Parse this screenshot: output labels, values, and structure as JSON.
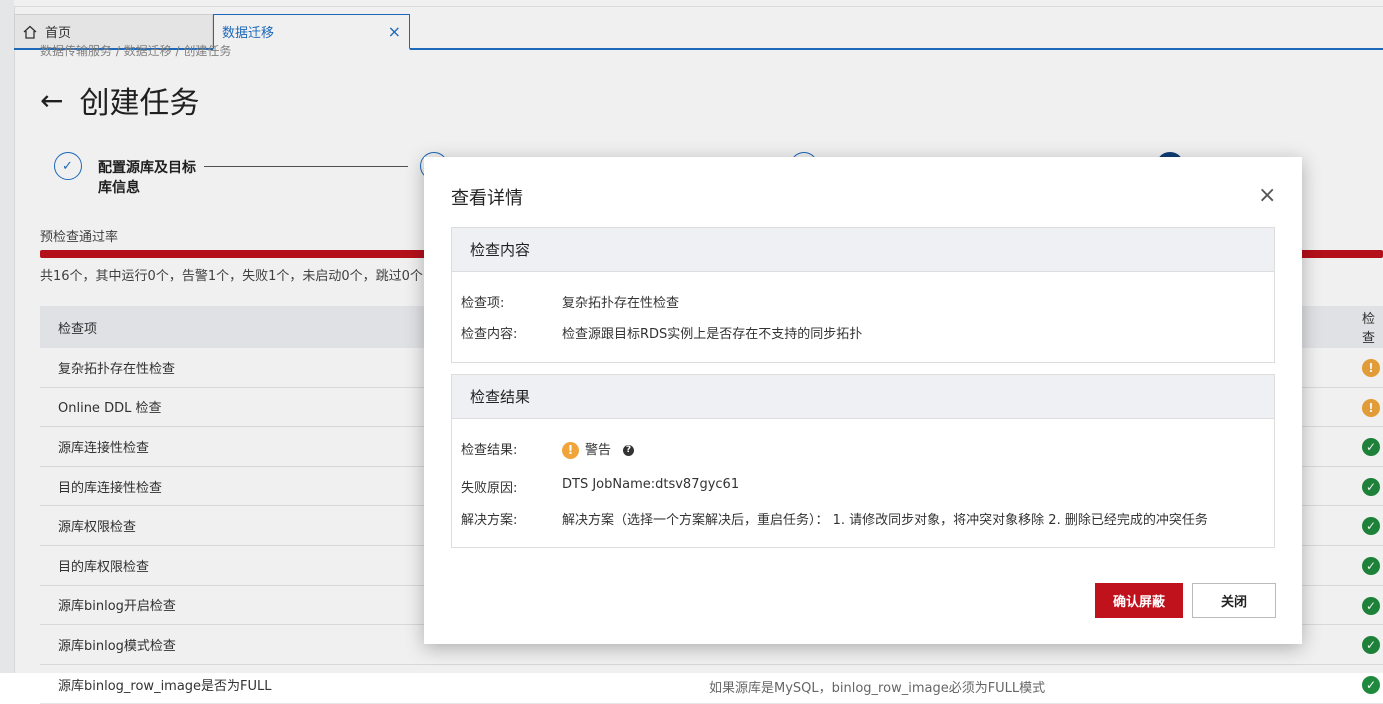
{
  "tabs": [
    {
      "label": "首页",
      "icon": "home-icon"
    },
    {
      "label": "数据迁移",
      "close": "×"
    }
  ],
  "page": {
    "breadcrumb": "数据传输服务 / 数据迁移 / 创建任务",
    "title": "创建任务",
    "back_icon": "←",
    "steps": [
      {
        "label": "配置源库及目标库信息",
        "status": "done"
      }
    ],
    "pass_rate_label": "预检查通过率",
    "summary": "共16个，其中运行0个，告警1个，失败1个，未启动0个，跳过0个",
    "table": {
      "headers": [
        "检查项",
        "检查"
      ],
      "rows": [
        {
          "name": "复杂拓扑存在性检查",
          "status": "warn"
        },
        {
          "name": "Online DDL 检查",
          "status": "warn"
        },
        {
          "name": "源库连接性检查",
          "status": "ok"
        },
        {
          "name": "目的库连接性检查",
          "status": "ok"
        },
        {
          "name": "源库权限检查",
          "status": "ok"
        },
        {
          "name": "目的库权限检查",
          "status": "ok"
        },
        {
          "name": "源库binlog开启检查",
          "status": "ok"
        },
        {
          "name": "源库binlog模式检查",
          "status": "ok"
        },
        {
          "name": "源库binlog_row_image是否为FULL",
          "status": "ok",
          "hint": "如果源库是MySQL，binlog_row_image必须为FULL模式"
        }
      ]
    }
  },
  "dialog": {
    "title": "查看详情",
    "close": "×",
    "section1": {
      "title": "检查内容",
      "item_label": "检查项:",
      "item_value": "复杂拓扑存在性检查",
      "content_label": "检查内容:",
      "content_value": "检查源跟目标RDS实例上是否存在不支持的同步拓扑"
    },
    "section2": {
      "title": "检查结果",
      "result_label": "检查结果:",
      "result_value": "警告",
      "reason_label": "失败原因:",
      "reason_value": "DTS JobName:dtsv87gyc61",
      "solution_label": "解决方案:",
      "solution_value": "解决方案（选择一个方案解决后，重启任务）： 1. 请修改同步对象，将冲突对象移除 2. 删除已经完成的冲突任务"
    },
    "confirm_button": "确认屏蔽",
    "close_button": "关闭"
  },
  "colors": {
    "accent": "#1f6fc5",
    "danger": "#c0121c",
    "warning": "#f0a53b",
    "success": "#1f8a3e"
  }
}
